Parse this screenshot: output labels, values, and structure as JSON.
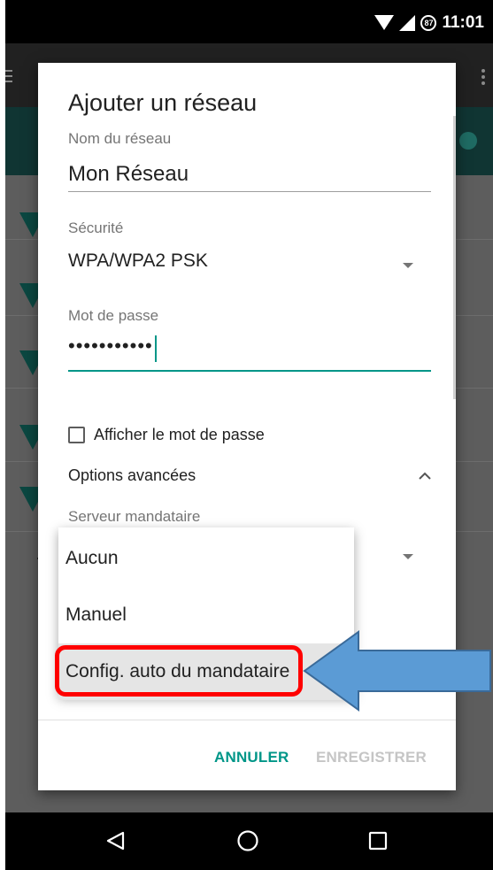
{
  "status_bar": {
    "time": "11:01",
    "battery_level": "87"
  },
  "dialog": {
    "title": "Ajouter un réseau",
    "network_name": {
      "label": "Nom du réseau",
      "value": "Mon Réseau"
    },
    "security": {
      "label": "Sécurité",
      "value": "WPA/WPA2 PSK"
    },
    "password": {
      "label": "Mot de passe",
      "masked_value": "•••••••••••"
    },
    "show_password_label": "Afficher le mot de passe",
    "advanced_options_label": "Options avancées",
    "proxy_label": "Serveur mandataire",
    "cancel_label": "ANNULER",
    "save_label": "ENREGISTRER"
  },
  "proxy_dropdown": {
    "options": [
      "Aucun",
      "Manuel",
      "Config. auto du mandataire"
    ],
    "highlighted_index": 2
  },
  "colors": {
    "accent": "#009688",
    "annotation_box": "#ff0000",
    "annotation_arrow": "#5b9bd5"
  }
}
